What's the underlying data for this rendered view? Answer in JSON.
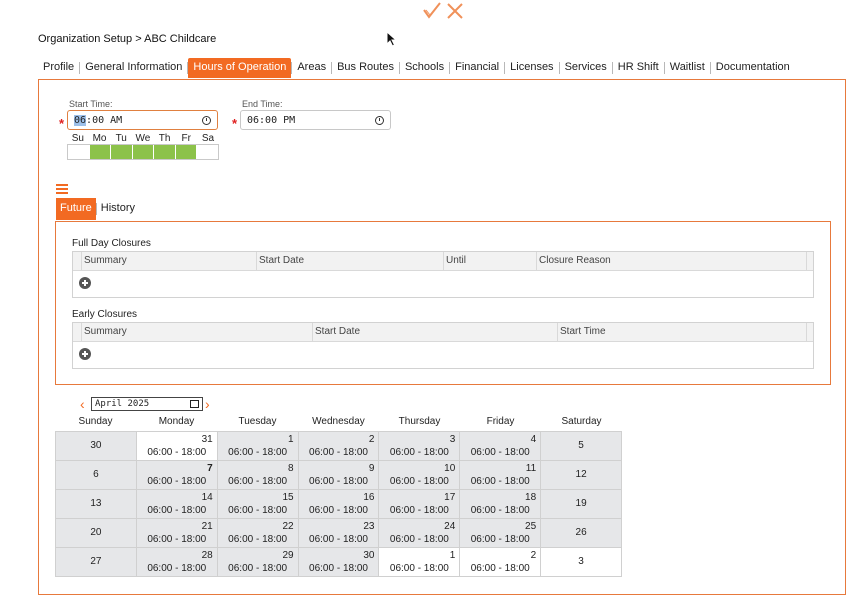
{
  "header": {
    "breadcrumb": "Organization Setup > ABC Childcare"
  },
  "tabs": [
    "Profile",
    "General Information",
    "Hours of Operation",
    "Areas",
    "Bus Routes",
    "Schools",
    "Financial",
    "Licenses",
    "Services",
    "HR Shift",
    "Waitlist",
    "Documentation"
  ],
  "active_tab": "Hours of Operation",
  "hours": {
    "start_label": "Start Time:",
    "start_hour": "06",
    "start_rest": ":00 AM",
    "end_label": "End Time:",
    "end_value": "06:00 PM",
    "required_mark": "*",
    "day_labels": [
      "Su",
      "Mo",
      "Tu",
      "We",
      "Th",
      "Fr",
      "Sa"
    ],
    "days_on": [
      false,
      true,
      true,
      true,
      true,
      true,
      false
    ]
  },
  "subtabs": [
    "Future",
    "History"
  ],
  "full_day": {
    "title": "Full Day Closures",
    "columns": [
      "Summary",
      "Start Date",
      "Until",
      "Closure Reason"
    ]
  },
  "early": {
    "title": "Early Closures",
    "columns": [
      "Summary",
      "Start Date",
      "Start Time"
    ]
  },
  "calendar": {
    "month": "April 2025",
    "weekdays": [
      "Sunday",
      "Monday",
      "Tuesday",
      "Wednesday",
      "Thursday",
      "Friday",
      "Saturday"
    ],
    "hours_text": "06:00 - 18:00",
    "weeks": [
      [
        {
          "d": "30",
          "h": false,
          "w": false
        },
        {
          "d": "31",
          "h": true,
          "w": true
        },
        {
          "d": "1",
          "h": true,
          "w": false
        },
        {
          "d": "2",
          "h": true,
          "w": false
        },
        {
          "d": "3",
          "h": true,
          "w": false
        },
        {
          "d": "4",
          "h": true,
          "w": false
        },
        {
          "d": "5",
          "h": false,
          "w": false
        }
      ],
      [
        {
          "d": "6",
          "h": false,
          "w": false
        },
        {
          "d": "7",
          "h": true,
          "w": false,
          "b": true
        },
        {
          "d": "8",
          "h": true,
          "w": false
        },
        {
          "d": "9",
          "h": true,
          "w": false
        },
        {
          "d": "10",
          "h": true,
          "w": false
        },
        {
          "d": "11",
          "h": true,
          "w": false
        },
        {
          "d": "12",
          "h": false,
          "w": false
        }
      ],
      [
        {
          "d": "13",
          "h": false,
          "w": false
        },
        {
          "d": "14",
          "h": true,
          "w": false
        },
        {
          "d": "15",
          "h": true,
          "w": false
        },
        {
          "d": "16",
          "h": true,
          "w": false
        },
        {
          "d": "17",
          "h": true,
          "w": false
        },
        {
          "d": "18",
          "h": true,
          "w": false
        },
        {
          "d": "19",
          "h": false,
          "w": false
        }
      ],
      [
        {
          "d": "20",
          "h": false,
          "w": false
        },
        {
          "d": "21",
          "h": true,
          "w": false
        },
        {
          "d": "22",
          "h": true,
          "w": false
        },
        {
          "d": "23",
          "h": true,
          "w": false
        },
        {
          "d": "24",
          "h": true,
          "w": false
        },
        {
          "d": "25",
          "h": true,
          "w": false
        },
        {
          "d": "26",
          "h": false,
          "w": false
        }
      ],
      [
        {
          "d": "27",
          "h": false,
          "w": false
        },
        {
          "d": "28",
          "h": true,
          "w": false
        },
        {
          "d": "29",
          "h": true,
          "w": false
        },
        {
          "d": "30",
          "h": true,
          "w": false
        },
        {
          "d": "1",
          "h": true,
          "w": true
        },
        {
          "d": "2",
          "h": true,
          "w": true
        },
        {
          "d": "3",
          "h": false,
          "w": true
        }
      ]
    ]
  },
  "colors": {
    "accent": "#f26a22",
    "day_on": "#8cc24a",
    "required": "#e01f1f"
  }
}
